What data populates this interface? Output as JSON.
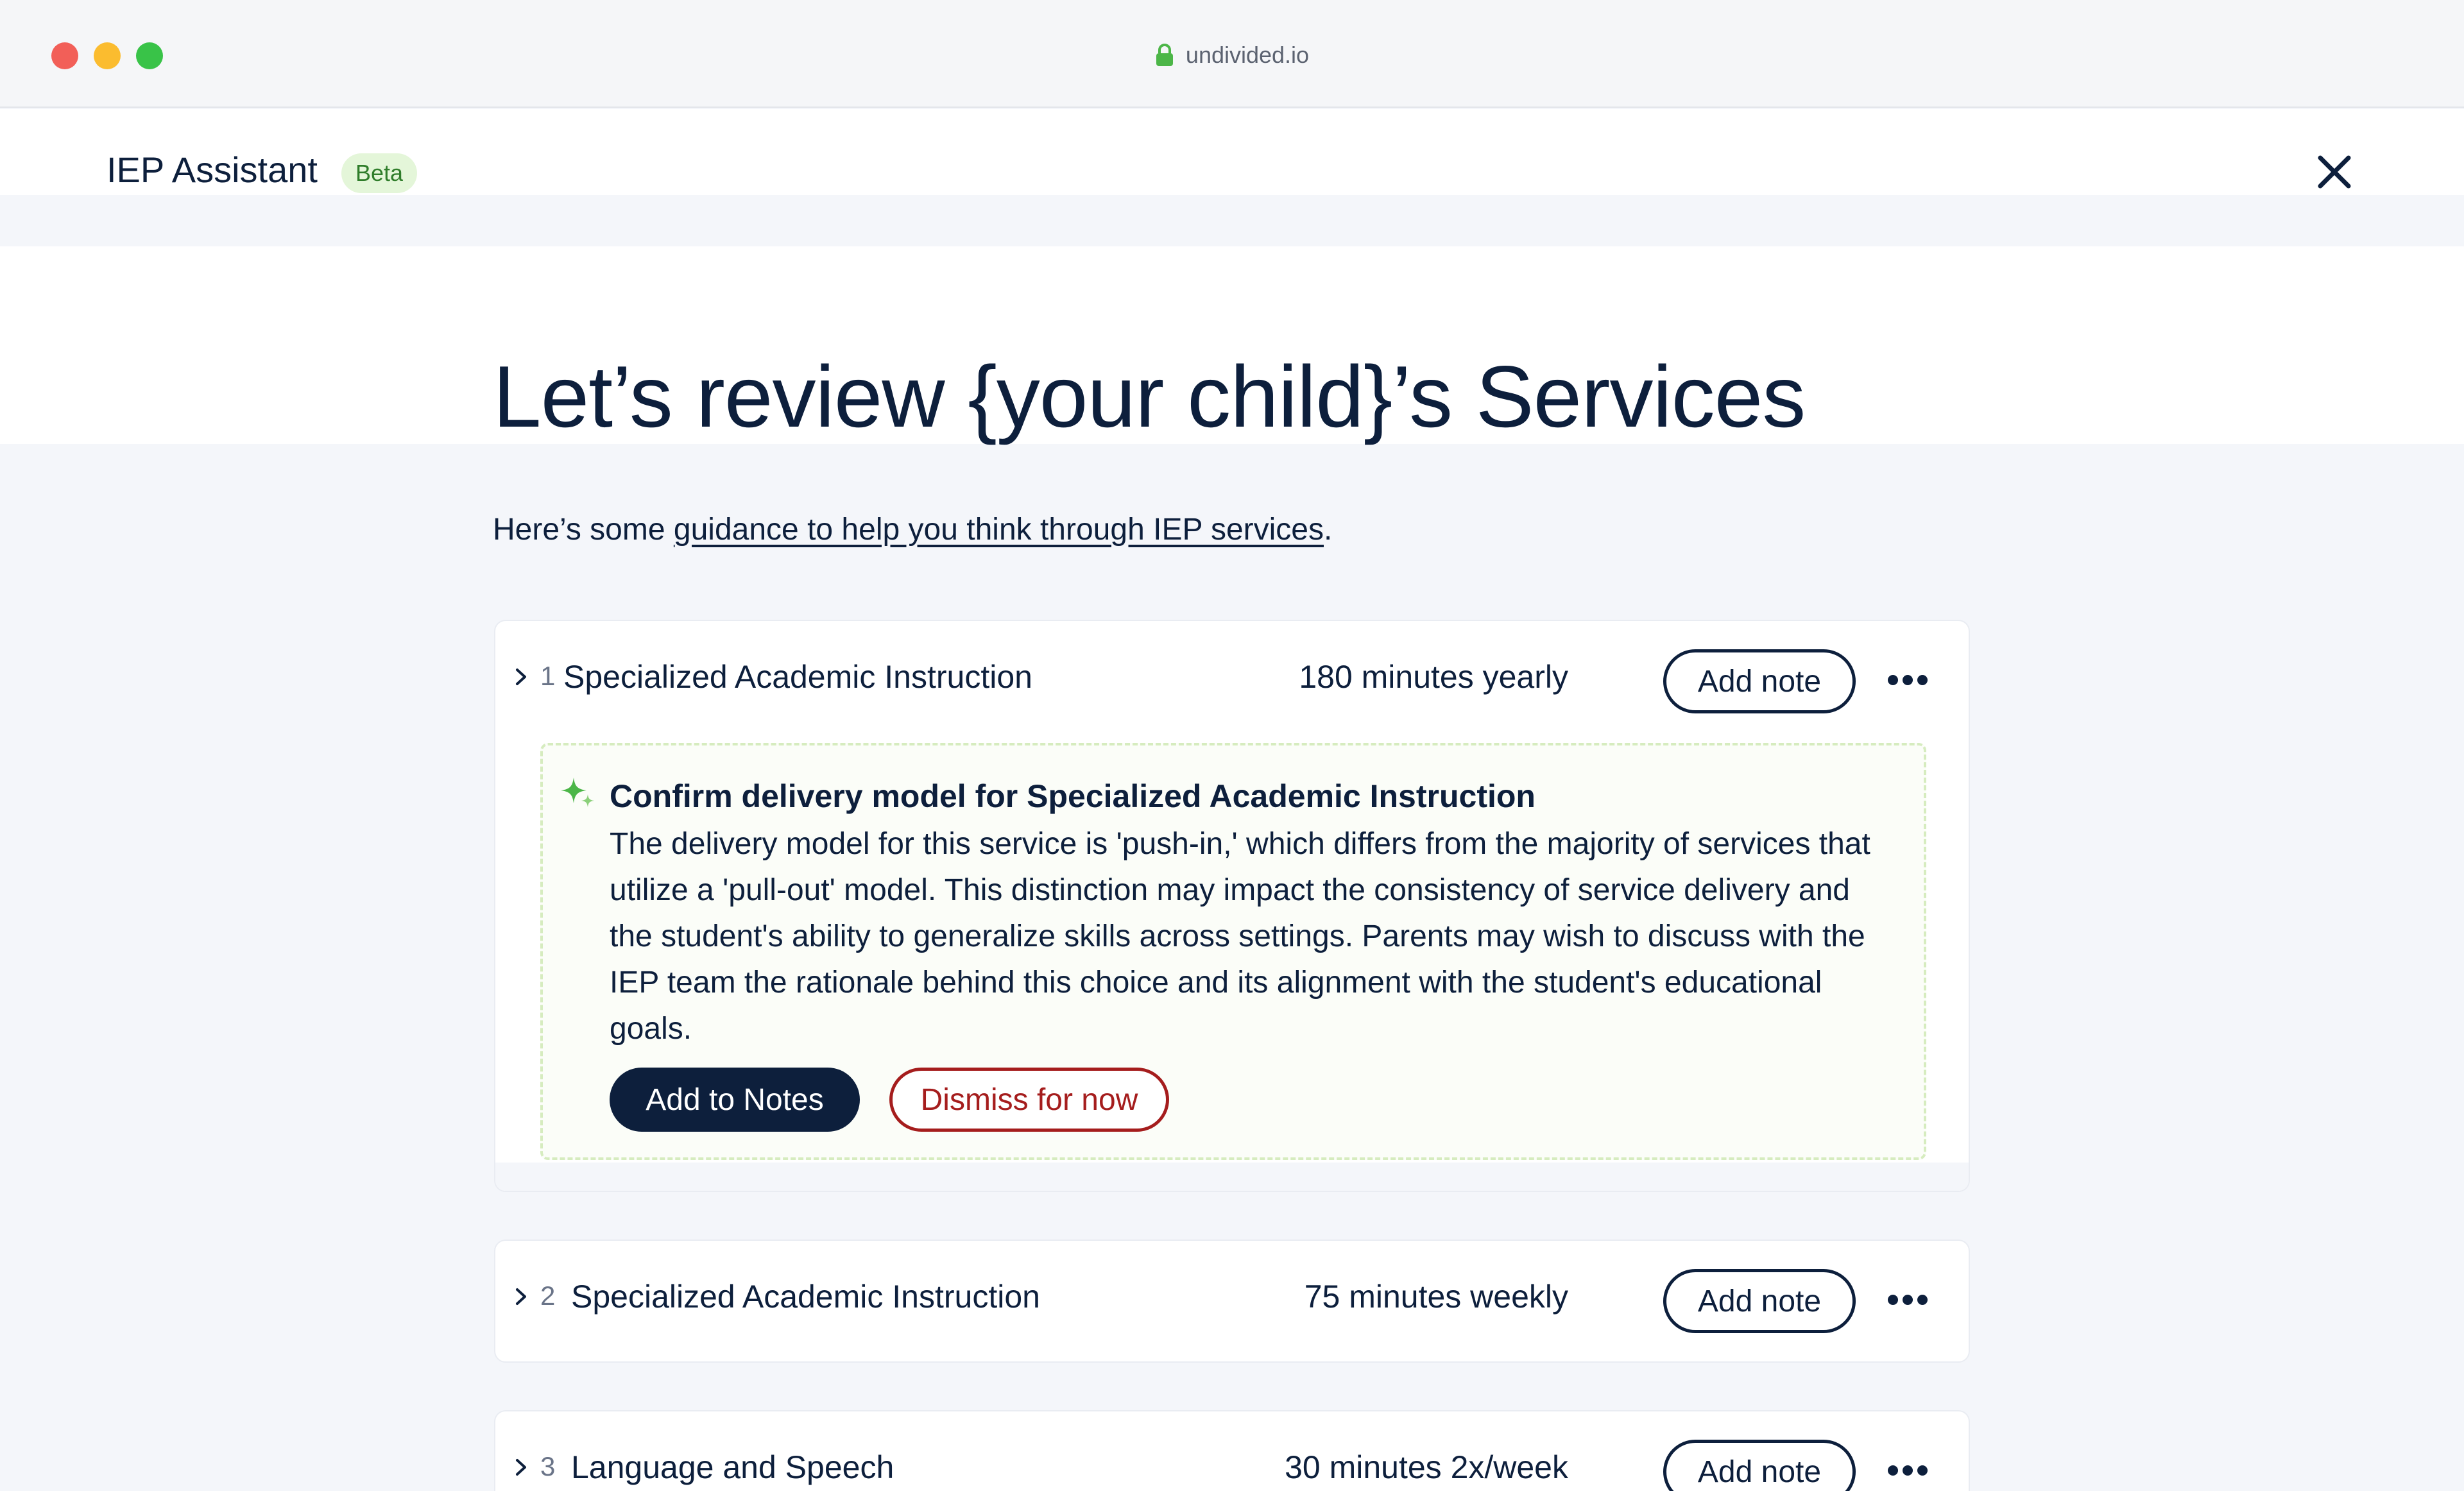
{
  "browser": {
    "url": "undivided.io"
  },
  "header": {
    "title": "IEP Assistant",
    "badge": "Beta"
  },
  "page": {
    "title": "Let’s review {your child}’s Services",
    "intro_prefix": "Here’s some ",
    "intro_link": "guidance to help you think through IEP services",
    "intro_suffix": "."
  },
  "services": [
    {
      "number": "1",
      "name": "Specialized Academic Instruction",
      "frequency": "180 minutes yearly",
      "add_note_label": "Add note"
    },
    {
      "number": "2",
      "name": "Specialized Academic Instruction",
      "frequency": "75 minutes weekly",
      "add_note_label": "Add note"
    },
    {
      "number": "3",
      "name": "Language and Speech",
      "frequency": "30 minutes 2x/week",
      "add_note_label": "Add note"
    }
  ],
  "suggestion": {
    "title": "Confirm delivery model for Specialized Academic Instruction",
    "body": "The delivery model for this service is 'push-in,' which differs from the majority of services that utilize a 'pull-out' model. This distinction may impact the consistency of service delivery and the student's ability to generalize skills across settings. Parents may wish to discuss with the IEP team the rationale behind this choice and its alignment with the student's educational goals.",
    "primary_label": "Add to Notes",
    "secondary_label": "Dismiss for now"
  },
  "colors": {
    "navy": "#0d1f3c",
    "accent_green": "#4cb648",
    "dismiss_red": "#a51d1d",
    "beta_bg": "#e4f6d9"
  },
  "icons": {
    "lock": "lock-icon",
    "close": "close-icon",
    "chevron": "chevron-right-icon",
    "more": "more-horizontal-icon",
    "sparkle": "sparkle-icon"
  }
}
